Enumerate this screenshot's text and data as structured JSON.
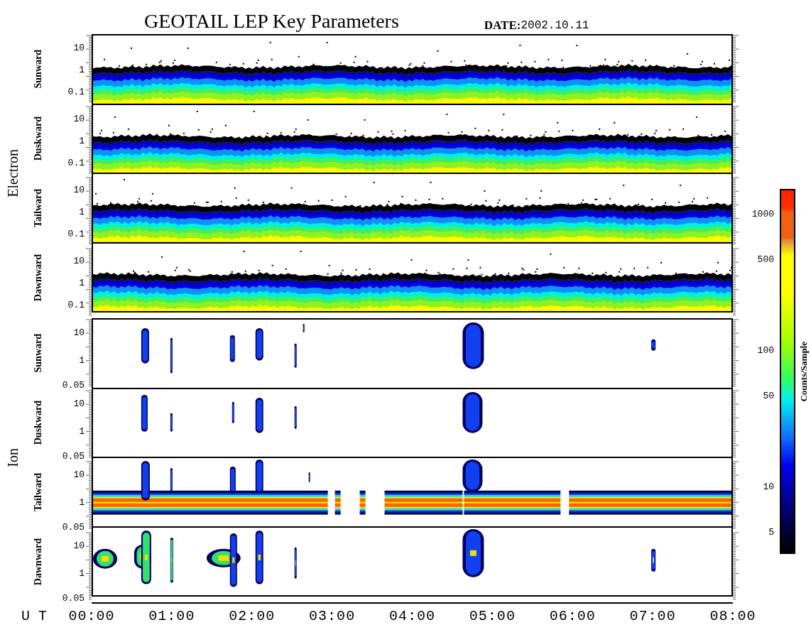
{
  "title": "GEOTAIL LEP Key Parameters",
  "date": {
    "label": "DATE:",
    "value": "2002.10.11"
  },
  "groups": [
    {
      "label": "Electron",
      "kind": "electron",
      "panels": [
        {
          "label": "Sunward",
          "yticks": [
            "10",
            "1",
            "0.1"
          ]
        },
        {
          "label": "Duskward",
          "yticks": [
            "10",
            "1",
            "0.1"
          ]
        },
        {
          "label": "Tailward",
          "yticks": [
            "10",
            "1",
            "0.1"
          ]
        },
        {
          "label": "Dawnward",
          "yticks": [
            "10",
            "1",
            "0.1"
          ]
        }
      ]
    },
    {
      "label": "Ion",
      "kind": "ion",
      "panels": [
        {
          "label": "Sunward",
          "yticks": [
            "10",
            "1",
            "0.05"
          ]
        },
        {
          "label": "Duskward",
          "yticks": [
            "10",
            "1",
            "0.05"
          ]
        },
        {
          "label": "Tailward",
          "yticks": [
            "10",
            "1",
            "0.05"
          ]
        },
        {
          "label": "Dawnward",
          "yticks": [
            "10",
            "1",
            "0.05"
          ]
        }
      ]
    }
  ],
  "x_axis": {
    "label": "U T",
    "ticks": [
      "00:00",
      "01:00",
      "02:00",
      "03:00",
      "04:00",
      "05:00",
      "06:00",
      "07:00",
      "08:00"
    ]
  },
  "colorbar": {
    "label": "Counts/Sample",
    "ticks": [
      "1000",
      "500",
      "100",
      "50",
      "10",
      "5"
    ]
  }
}
